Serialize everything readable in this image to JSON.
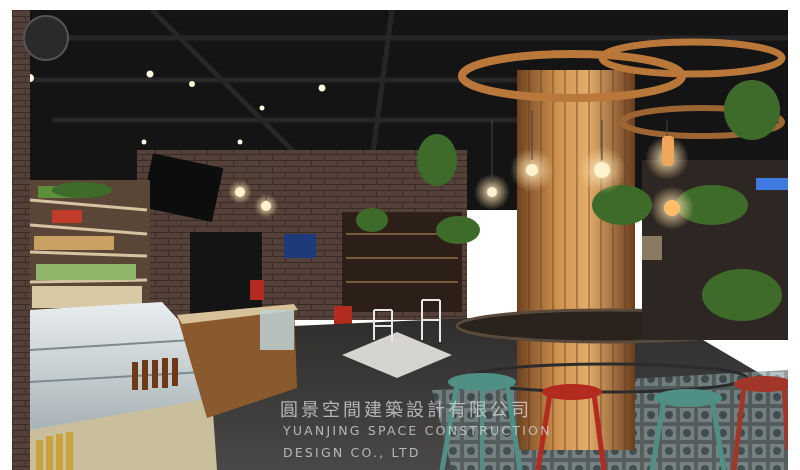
{
  "photo": {
    "subject": "restaurant interior",
    "colors": {
      "ceiling": "#141414",
      "brick": "#4a3a30",
      "wood": "#a9713a",
      "warm_light": "#ffd79a",
      "floor": "#3b3a3a",
      "accent_red": "#b32a1f",
      "accent_teal": "#4f8f86"
    }
  },
  "watermark": {
    "line_cn": "圓景空間建築設計有限公司",
    "line_en_1": "YUANJING SPACE CONSTRUCTION",
    "line_en_2": "DESIGN CO., LTD"
  }
}
